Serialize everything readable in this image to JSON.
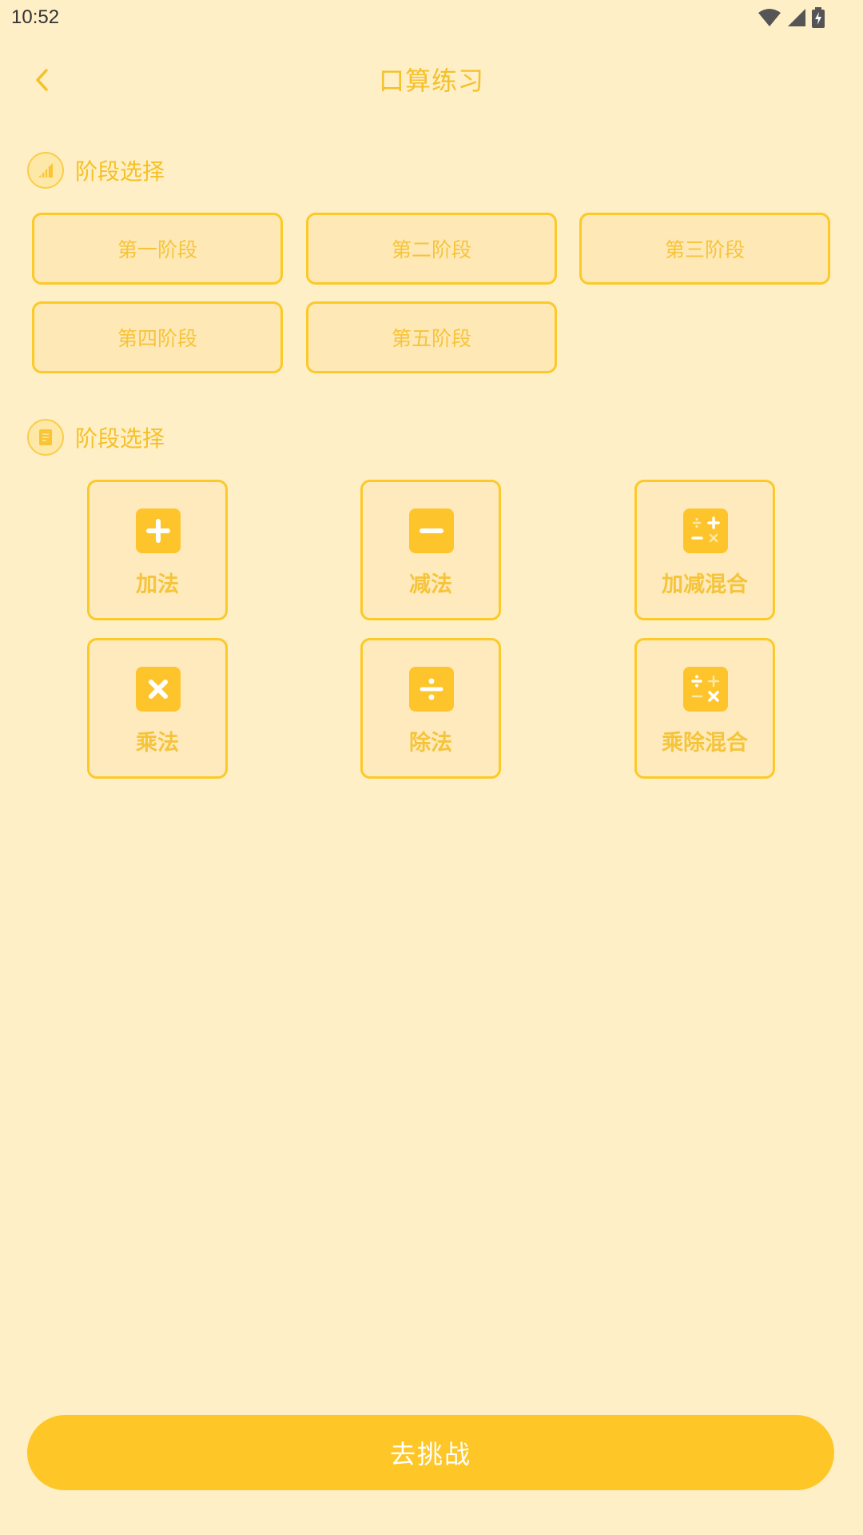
{
  "status": {
    "time": "10:52"
  },
  "header": {
    "title": "口算练习"
  },
  "stage_section": {
    "label": "阶段选择",
    "stages": [
      "第一阶段",
      "第二阶段",
      "第三阶段",
      "第四阶段",
      "第五阶段"
    ]
  },
  "operation_section": {
    "label": "阶段选择",
    "operations": [
      {
        "label": "加法",
        "icon": "plus-icon"
      },
      {
        "label": "减法",
        "icon": "minus-icon"
      },
      {
        "label": "加减混合",
        "icon": "mixed-operations-icon"
      },
      {
        "label": "乘法",
        "icon": "multiply-icon"
      },
      {
        "label": "除法",
        "icon": "divide-icon"
      },
      {
        "label": "乘除混合",
        "icon": "mixed-operations-icon"
      }
    ]
  },
  "footer": {
    "challenge_label": "去挑战"
  },
  "colors": {
    "background": "#FEEFC6",
    "accent": "#FEC626",
    "text_accent": "#F5C028"
  }
}
